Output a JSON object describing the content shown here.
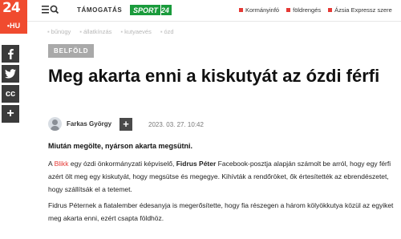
{
  "header": {
    "logo_number": "24",
    "logo_domain": "•HU",
    "support_label": "TÁMOGATÁS",
    "sport_label_a": "SPORT",
    "sport_label_b": "24",
    "links": [
      {
        "label": "Kormányinfó"
      },
      {
        "label": "földrengés"
      },
      {
        "label": "Ázsia Expressz szere"
      }
    ]
  },
  "tags": [
    "bűnügy",
    "állatkínzás",
    "kutyaevés",
    "ózd"
  ],
  "social": [
    {
      "icon": "facebook-icon",
      "glyph": "f"
    },
    {
      "icon": "twitter-icon",
      "glyph": "t"
    },
    {
      "icon": "creative-commons-icon",
      "glyph": "cc"
    },
    {
      "icon": "plus-icon",
      "glyph": "+"
    }
  ],
  "article": {
    "category": "BELFÖLD",
    "title": "Meg akarta enni a kiskutyát az ózdi férfi",
    "author": "Farkas György",
    "follow_symbol": "+",
    "date": "2023. 03. 27. 10:42",
    "lead": "Miután megölte, nyárson akarta megsütni.",
    "p1": {
      "before_link": "A ",
      "link": "Blikk",
      "after_link": " egy ózdi önkormányzati képviselő, ",
      "bold_name": "Fidrus Péter",
      "rest": " Facebook-posztja alapján számolt be arról, hogy egy férfi azért ölt meg egy kiskutyát, hogy megsütse és megegye. Kihívták a rendőröket, ők értesítették az ebrendészetet, hogy szállítsák el a tetemet."
    },
    "p2": "Fidrus Péternek a fiatalember édesanyja is megerősítette, hogy fia részegen a három kölyökkutya közül az egyiket meg akarta enni, ezért csapta földhöz."
  },
  "colors": {
    "brand_red": "#f04b2f",
    "sport_green": "#1a9b3c",
    "link_red": "#e53935"
  }
}
